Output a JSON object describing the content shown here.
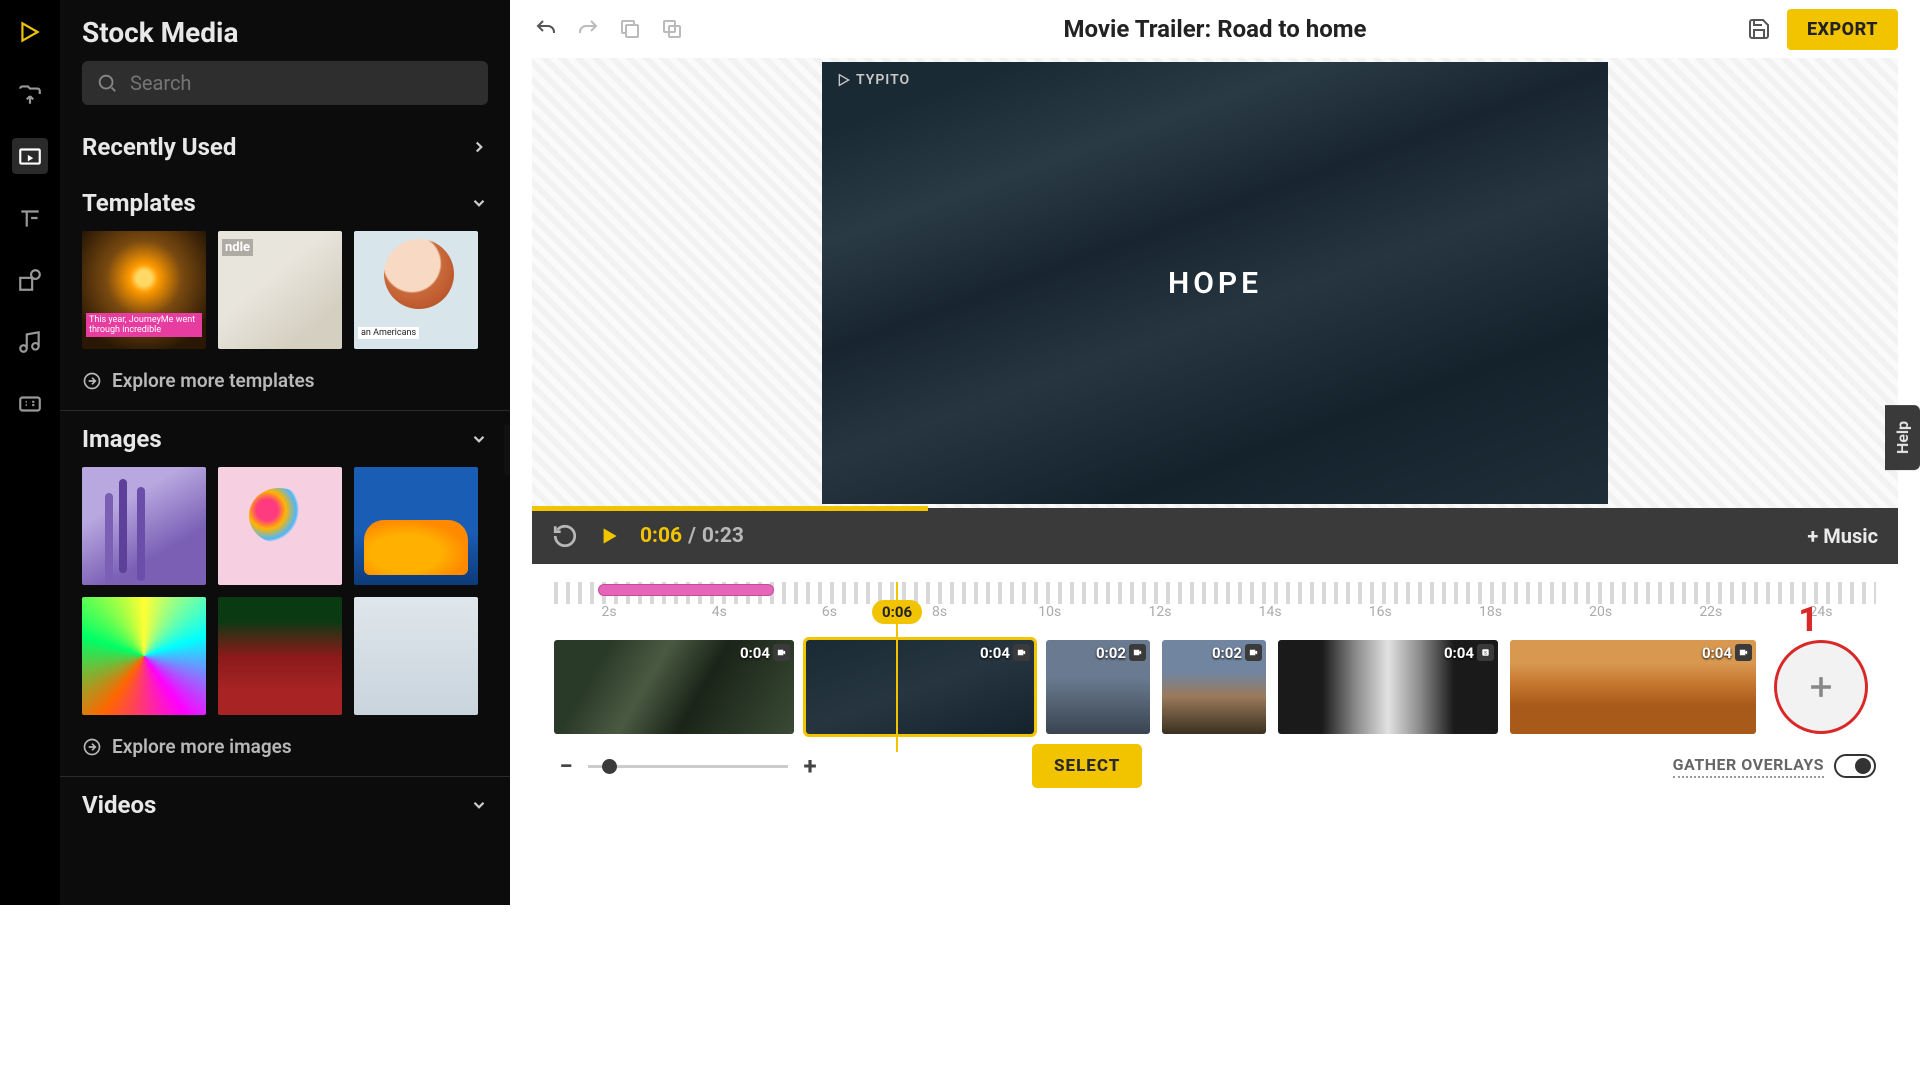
{
  "project_title": "Movie Trailer: Road to home",
  "export_label": "EXPORT",
  "sidebar": {
    "title": "Stock Media",
    "search_placeholder": "Search",
    "recently_used": "Recently Used",
    "templates_label": "Templates",
    "explore_templates": "Explore more templates",
    "images_label": "Images",
    "explore_images": "Explore more images",
    "videos_label": "Videos"
  },
  "preview": {
    "watermark": "TYPITO",
    "overlay_text": "HOPE"
  },
  "playbar": {
    "current": "0:06",
    "duration": "0:23",
    "music_label": "+ Music"
  },
  "help_label": "Help",
  "timeline": {
    "playhead_label": "0:06",
    "labels": [
      "2s",
      "4s",
      "6s",
      "8s",
      "10s",
      "12s",
      "14s",
      "16s",
      "18s",
      "20s",
      "22s",
      "24s"
    ],
    "clips": [
      {
        "duration": "0:04",
        "type": "video"
      },
      {
        "duration": "0:04",
        "type": "video",
        "selected": true
      },
      {
        "duration": "0:02",
        "type": "video"
      },
      {
        "duration": "0:02",
        "type": "video"
      },
      {
        "duration": "0:04",
        "type": "stock"
      },
      {
        "duration": "0:04",
        "type": "video"
      }
    ],
    "select_label": "SELECT",
    "gather_label": "GATHER OVERLAYS",
    "annotation": "1"
  }
}
